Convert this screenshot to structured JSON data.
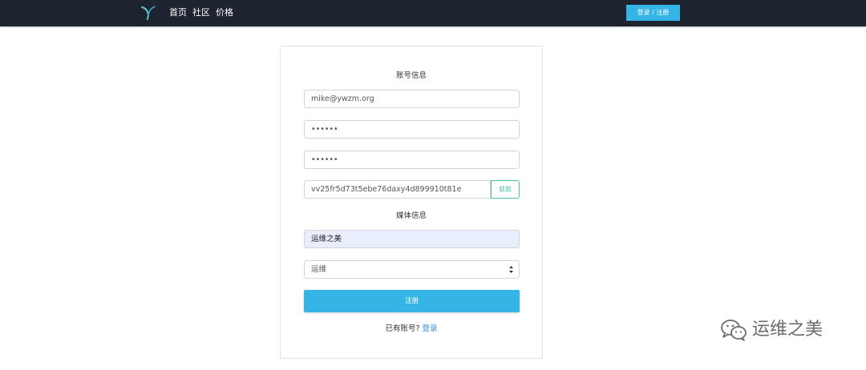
{
  "nav": {
    "links": [
      "首页",
      "社区",
      "价格"
    ],
    "login_register": "登录 / 注册"
  },
  "form": {
    "account_section_title": "账号信息",
    "email_value": "mike@ywzm.org",
    "password_value": "••••••",
    "confirm_password_value": "••••••",
    "invite_code_value": "vv25fr5d73t5ebe76daxy4d899910t81e",
    "fetch_button": "获取",
    "media_section_title": "媒体信息",
    "media_name_value": "运维之美",
    "category_selected": "运维",
    "register_button": "注册",
    "have_account_text": "已有账号?",
    "login_link": "登录"
  },
  "watermark": {
    "text": "运维之美"
  },
  "colors": {
    "navbar_bg": "#1e2330",
    "primary_blue": "#35b5e6",
    "teal_accent": "#4dbdae",
    "link_blue": "#2f8fe0",
    "autofill_bg": "#e8eefb"
  },
  "icons": {
    "logo": "leaf-logo-icon",
    "select": "select-arrows-icon",
    "watermark": "wechat-icon"
  }
}
